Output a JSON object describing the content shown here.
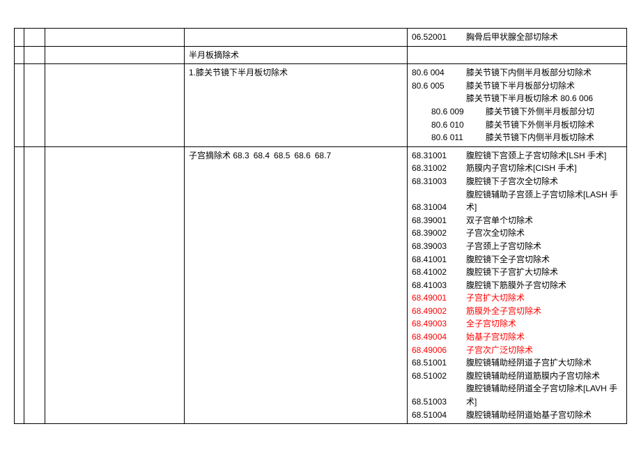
{
  "rows": [
    {
      "c0": "",
      "c1": "",
      "c2": "",
      "c3": "",
      "c4": [
        {
          "code": "06.52001",
          "desc": "胸骨后甲状腺全部切除术"
        }
      ]
    },
    {
      "c0": "",
      "c1": "",
      "c2": "",
      "c3": "半月板摘除术",
      "c4": []
    },
    {
      "c0": "",
      "c1": "",
      "c2": "",
      "c3": "1.膝关节镜下半月板切除术",
      "c4": [
        {
          "code": "80.6 004",
          "desc": "膝关节镜下内侧半月板部分切除术"
        },
        {
          "code": "80.6 005",
          "desc": "膝关节镜下半月板部分切除术"
        },
        {
          "code": "",
          "desc": "膝关节镜下半月板切除术 80.6 006"
        },
        {
          "code": "80.6 009",
          "desc": "膝关节镜下外侧半月板部分切",
          "indent": true
        },
        {
          "code": "80.6 010",
          "desc": "膝关节镜下外侧半月板切除术",
          "indent": true
        },
        {
          "code": "80.6 011",
          "desc": "膝关节镜下内侧半月板切除术",
          "indent": true
        }
      ]
    },
    {
      "c0": "",
      "c1": "",
      "c2": "",
      "c3": "子宫摘除术 68.3 68.4 68.5 68.6 68.7",
      "c4": [
        {
          "code": "68.31001",
          "desc": "腹腔镜下宫颈上子宫切除术[LSH 手术]"
        },
        {
          "code": "68.31002",
          "desc": "筋膜内子宫切除术[CISH 手术]"
        },
        {
          "code": "68.31003",
          "desc": "腹腔镜下子宫次全切除术"
        },
        {
          "code": "",
          "desc": "腹腔镜辅助子宫颈上子宫切除术[LASH 手"
        },
        {
          "code": "68.31004",
          "desc": "术]"
        },
        {
          "code": "68.39001",
          "desc": "双子宫单个切除术"
        },
        {
          "code": "68.39002",
          "desc": "子宫次全切除术"
        },
        {
          "code": "68.39003",
          "desc": "子宫颈上子宫切除术"
        },
        {
          "code": "68.41001",
          "desc": "腹腔镜下全子宫切除术"
        },
        {
          "code": "68.41002",
          "desc": "腹腔镜下子宫扩大切除术"
        },
        {
          "code": "68.41003",
          "desc": "腹腔镜下筋膜外子宫切除术"
        },
        {
          "code": "68.49001",
          "desc": "子宫扩大切除术",
          "red": true
        },
        {
          "code": "68.49002",
          "desc": "筋膜外全子宫切除术",
          "red": true
        },
        {
          "code": "68.49003",
          "desc": "全子宫切除术",
          "red": true
        },
        {
          "code": "68.49004",
          "desc": "始基子宫切除术",
          "red": true
        },
        {
          "code": "68.49006",
          "desc": "子宫次广泛切除术",
          "red": true
        },
        {
          "code": "68.51001",
          "desc": "腹腔镜辅助经阴道子宫扩大切除术"
        },
        {
          "code": "68.51002",
          "desc": "腹腔镜辅助经阴道筋膜内子宫切除术"
        },
        {
          "code": "",
          "desc": "腹腔镜辅助经阴道全子宫切除术[LAVH 手"
        },
        {
          "code": "68.51003",
          "desc": "术]"
        },
        {
          "code": "68.51004",
          "desc": "腹腔镜辅助经阴道始基子宫切除术"
        }
      ]
    }
  ]
}
